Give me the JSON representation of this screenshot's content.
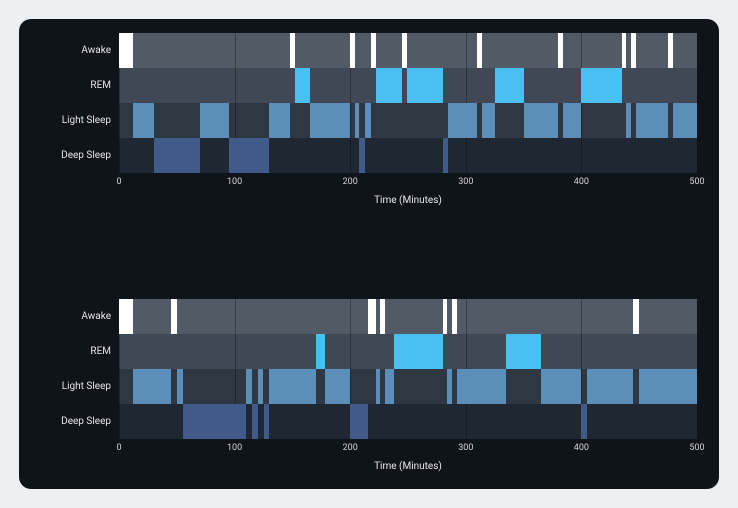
{
  "chart_data": [
    {
      "type": "bar",
      "title": "",
      "xlabel": "Time (Minutes)",
      "ylabel": "",
      "xlim": [
        0,
        500
      ],
      "xticks": [
        0,
        100,
        200,
        300,
        400,
        500
      ],
      "categories": [
        "Awake",
        "REM",
        "Light Sleep",
        "Deep Sleep"
      ],
      "stage_colors": {
        "Awake": "#ffffff",
        "REM": "#4abff2",
        "Light Sleep": "#5b8fb9",
        "Deep Sleep": "#405a8a"
      },
      "segments": [
        {
          "start": 0,
          "end": 12,
          "stage": "Awake"
        },
        {
          "start": 12,
          "end": 30,
          "stage": "Light Sleep"
        },
        {
          "start": 30,
          "end": 70,
          "stage": "Deep Sleep"
        },
        {
          "start": 70,
          "end": 95,
          "stage": "Light Sleep"
        },
        {
          "start": 95,
          "end": 130,
          "stage": "Deep Sleep"
        },
        {
          "start": 130,
          "end": 148,
          "stage": "Light Sleep"
        },
        {
          "start": 148,
          "end": 152,
          "stage": "Awake"
        },
        {
          "start": 152,
          "end": 165,
          "stage": "REM"
        },
        {
          "start": 165,
          "end": 200,
          "stage": "Light Sleep"
        },
        {
          "start": 200,
          "end": 204,
          "stage": "Awake"
        },
        {
          "start": 204,
          "end": 208,
          "stage": "Light Sleep"
        },
        {
          "start": 208,
          "end": 213,
          "stage": "Deep Sleep"
        },
        {
          "start": 213,
          "end": 218,
          "stage": "Light Sleep"
        },
        {
          "start": 218,
          "end": 222,
          "stage": "Awake"
        },
        {
          "start": 222,
          "end": 245,
          "stage": "REM"
        },
        {
          "start": 245,
          "end": 249,
          "stage": "Awake"
        },
        {
          "start": 249,
          "end": 280,
          "stage": "REM"
        },
        {
          "start": 280,
          "end": 285,
          "stage": "Deep Sleep"
        },
        {
          "start": 285,
          "end": 310,
          "stage": "Light Sleep"
        },
        {
          "start": 310,
          "end": 314,
          "stage": "Awake"
        },
        {
          "start": 314,
          "end": 325,
          "stage": "Light Sleep"
        },
        {
          "start": 325,
          "end": 350,
          "stage": "REM"
        },
        {
          "start": 350,
          "end": 380,
          "stage": "Light Sleep"
        },
        {
          "start": 380,
          "end": 384,
          "stage": "Awake"
        },
        {
          "start": 384,
          "end": 400,
          "stage": "Light Sleep"
        },
        {
          "start": 400,
          "end": 435,
          "stage": "REM"
        },
        {
          "start": 435,
          "end": 439,
          "stage": "Awake"
        },
        {
          "start": 439,
          "end": 443,
          "stage": "Light Sleep"
        },
        {
          "start": 443,
          "end": 447,
          "stage": "Awake"
        },
        {
          "start": 447,
          "end": 475,
          "stage": "Light Sleep"
        },
        {
          "start": 475,
          "end": 479,
          "stage": "Awake"
        },
        {
          "start": 479,
          "end": 500,
          "stage": "Light Sleep"
        }
      ]
    },
    {
      "type": "bar",
      "title": "",
      "xlabel": "Time (Minutes)",
      "ylabel": "",
      "xlim": [
        0,
        500
      ],
      "xticks": [
        0,
        100,
        200,
        300,
        400,
        500
      ],
      "categories": [
        "Awake",
        "REM",
        "Light Sleep",
        "Deep Sleep"
      ],
      "stage_colors": {
        "Awake": "#ffffff",
        "REM": "#4abff2",
        "Light Sleep": "#5b8fb9",
        "Deep Sleep": "#405a8a"
      },
      "segments": [
        {
          "start": 0,
          "end": 12,
          "stage": "Awake"
        },
        {
          "start": 12,
          "end": 45,
          "stage": "Light Sleep"
        },
        {
          "start": 45,
          "end": 50,
          "stage": "Awake"
        },
        {
          "start": 50,
          "end": 55,
          "stage": "Light Sleep"
        },
        {
          "start": 55,
          "end": 110,
          "stage": "Deep Sleep"
        },
        {
          "start": 110,
          "end": 115,
          "stage": "Light Sleep"
        },
        {
          "start": 115,
          "end": 120,
          "stage": "Deep Sleep"
        },
        {
          "start": 120,
          "end": 125,
          "stage": "Light Sleep"
        },
        {
          "start": 125,
          "end": 130,
          "stage": "Deep Sleep"
        },
        {
          "start": 130,
          "end": 170,
          "stage": "Light Sleep"
        },
        {
          "start": 170,
          "end": 178,
          "stage": "REM"
        },
        {
          "start": 178,
          "end": 200,
          "stage": "Light Sleep"
        },
        {
          "start": 200,
          "end": 215,
          "stage": "Deep Sleep"
        },
        {
          "start": 215,
          "end": 222,
          "stage": "Awake"
        },
        {
          "start": 222,
          "end": 226,
          "stage": "Light Sleep"
        },
        {
          "start": 226,
          "end": 230,
          "stage": "Awake"
        },
        {
          "start": 230,
          "end": 238,
          "stage": "Light Sleep"
        },
        {
          "start": 238,
          "end": 280,
          "stage": "REM"
        },
        {
          "start": 280,
          "end": 284,
          "stage": "Awake"
        },
        {
          "start": 284,
          "end": 288,
          "stage": "Light Sleep"
        },
        {
          "start": 288,
          "end": 292,
          "stage": "Awake"
        },
        {
          "start": 292,
          "end": 335,
          "stage": "Light Sleep"
        },
        {
          "start": 335,
          "end": 365,
          "stage": "REM"
        },
        {
          "start": 365,
          "end": 400,
          "stage": "Light Sleep"
        },
        {
          "start": 400,
          "end": 405,
          "stage": "Deep Sleep"
        },
        {
          "start": 405,
          "end": 445,
          "stage": "Light Sleep"
        },
        {
          "start": 445,
          "end": 450,
          "stage": "Awake"
        },
        {
          "start": 450,
          "end": 500,
          "stage": "Light Sleep"
        }
      ]
    }
  ]
}
